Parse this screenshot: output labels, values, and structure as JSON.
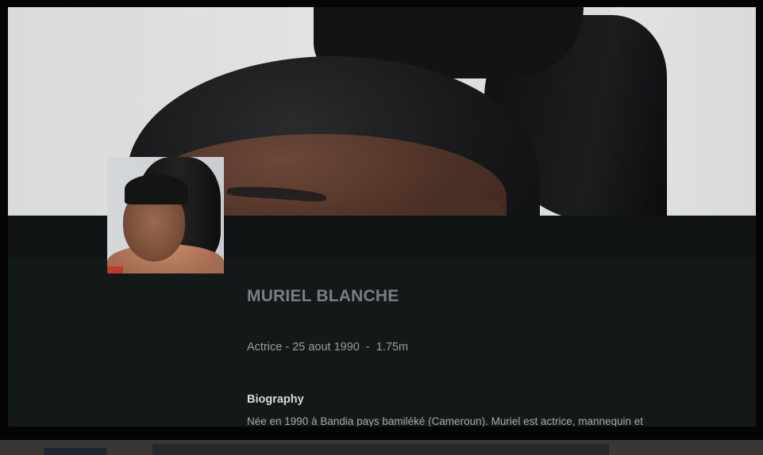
{
  "profile": {
    "name": "MURIEL BLANCHE",
    "meta": "Actrice - 25 aout 1990  -  1.75m",
    "biography_heading": "Biography",
    "biography_text": "Née en 1990 à Bandia pays bamiléké (Cameroun). Muriel est actrice, mannequin et"
  },
  "images": {
    "hero": "backdrop-photo",
    "thumbnail": "profile-photo"
  },
  "colors": {
    "panel_background": "#131818",
    "name_text": "#7b7e80",
    "meta_text": "#9a9c9d",
    "heading_text": "#dadada"
  }
}
